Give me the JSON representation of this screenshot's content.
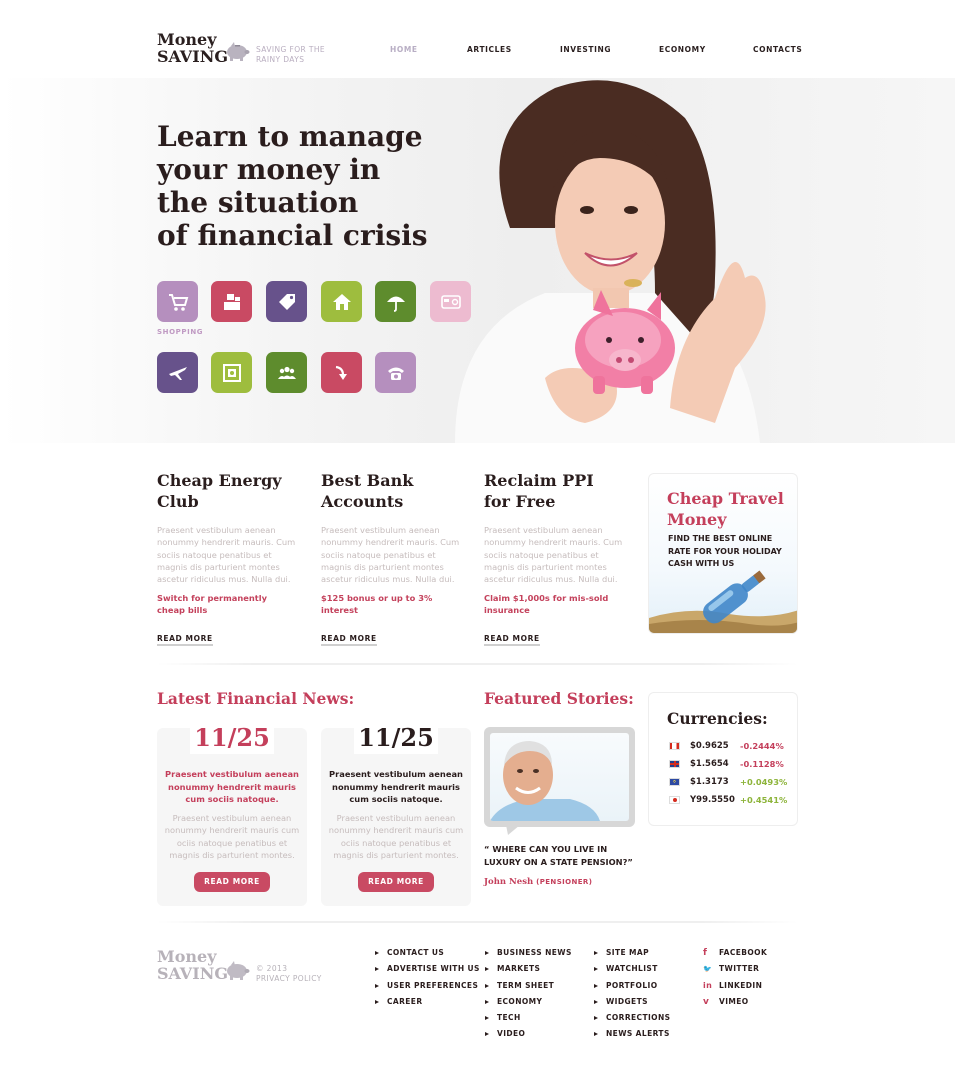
{
  "header": {
    "logo_line1": "Money",
    "logo_line2": "SAVING",
    "tagline_line1": "SAVING FOR THE",
    "tagline_line2": "RAINY DAYS",
    "nav": [
      "HOME",
      "ARTICLES",
      "INVESTING",
      "ECONOMY",
      "CONTACTS"
    ]
  },
  "hero": {
    "title_lines": [
      "Learn to manage",
      "your money in",
      "the situation",
      "of financial crisis"
    ],
    "tile_caption": "SHOPPING",
    "tiles": [
      {
        "icon": "cart-icon",
        "color": "#b58fbe"
      },
      {
        "icon": "cash-register-icon",
        "color": "#c94a63"
      },
      {
        "icon": "tag-icon",
        "color": "#67528b"
      },
      {
        "icon": "house-icon",
        "color": "#9ebd3e"
      },
      {
        "icon": "umbrella-icon",
        "color": "#5e8c2d"
      },
      {
        "icon": "credit-card-icon",
        "color": "#edbbd0"
      },
      {
        "icon": "airplane-icon",
        "color": "#67528b"
      },
      {
        "icon": "safe-icon",
        "color": "#9ebd3e"
      },
      {
        "icon": "people-icon",
        "color": "#5e8c2d"
      },
      {
        "icon": "arrow-down-icon",
        "color": "#c94a63"
      },
      {
        "icon": "phone-icon",
        "color": "#b58fbe"
      }
    ]
  },
  "columns": [
    {
      "title_lines": [
        "Cheap Energy",
        "Club"
      ],
      "body": "Praesent vestibulum aenean nonummy hendrerit mauris. Cum sociis natoque penatibus et magnis dis parturient montes ascetur ridiculus mus. Nulla dui.",
      "link_lines": [
        "Switch for permanently",
        "cheap bills"
      ],
      "read_more": "READ MORE"
    },
    {
      "title_lines": [
        "Best Bank",
        "Accounts"
      ],
      "body": "Praesent vestibulum aenean nonummy hendrerit mauris. Cum sociis natoque penatibus et magnis dis parturient montes ascetur ridiculus mus. Nulla dui.",
      "link_lines": [
        "$125 bonus or up to 3%",
        "interest"
      ],
      "read_more": "READ MORE"
    },
    {
      "title_lines": [
        "Reclaim PPI",
        "for Free"
      ],
      "body": "Praesent vestibulum aenean nonummy hendrerit mauris. Cum sociis natoque penatibus et magnis dis parturient montes ascetur ridiculus mus. Nulla dui.",
      "link_lines": [
        "Claim $1,000s for mis-sold",
        "insurance"
      ],
      "read_more": "READ MORE"
    }
  ],
  "travel": {
    "title_lines": [
      "Cheap Travel",
      "Money"
    ],
    "text_lines": [
      "FIND THE BEST ONLINE",
      "RATE FOR YOUR HOLIDAY",
      "CASH WITH US"
    ]
  },
  "news": {
    "title": "Latest Financial News:",
    "items": [
      {
        "date": "11/25",
        "lead": "Praesent vestibulum aenean nonummy hendrerit mauris cum sociis natoque.",
        "body": "Praesent vestibulum aenean nonummy hendrerit mauris cum ociis natoque penatibus et magnis dis parturient montes.",
        "button": "READ MORE",
        "accent": "#c43f5b"
      },
      {
        "date": "11/25",
        "lead": "Praesent vestibulum aenean nonummy hendrerit mauris cum sociis natoque.",
        "body": "Praesent vestibulum aenean nonummy hendrerit mauris cum ociis natoque penatibus et magnis dis parturient montes.",
        "button": "READ MORE",
        "accent": "#2a1d1d"
      }
    ]
  },
  "featured": {
    "title": "Featured Stories:",
    "quote_lines": [
      "“ WHERE CAN YOU LIVE IN",
      "LUXURY ON A STATE PENSION?”"
    ],
    "author": "John Nesh",
    "author_role": "(PENSIONER)"
  },
  "currencies": {
    "title": "Currencies:",
    "rows": [
      {
        "flag": "canada-flag-icon",
        "rate": "$0.9625",
        "change": "-0.2444%",
        "dir": "down"
      },
      {
        "flag": "uk-flag-icon",
        "rate": "$1.5654",
        "change": "-0.1128%",
        "dir": "down"
      },
      {
        "flag": "eu-flag-icon",
        "rate": "$1.3173",
        "change": "+0.0493%",
        "dir": "up"
      },
      {
        "flag": "japan-flag-icon",
        "rate": "Y99.5550",
        "change": "+0.4541%",
        "dir": "up"
      }
    ],
    "down_color": "#c43f5b",
    "up_color": "#8db43a"
  },
  "footer": {
    "logo_line1": "Money",
    "logo_line2": "SAVING",
    "copyright": "© 2013",
    "privacy": "PRIVACY POLICY",
    "col1": [
      "CONTACT US",
      "ADVERTISE WITH US",
      "USER PREFERENCES",
      "CAREER"
    ],
    "col2": [
      "BUSINESS NEWS",
      "MARKETS",
      "TERM SHEET",
      "ECONOMY",
      "TECH",
      "VIDEO"
    ],
    "col3": [
      "SITE MAP",
      "WATCHLIST",
      "PORTFOLIO",
      "WIDGETS",
      "CORRECTIONS",
      "NEWS ALERTS"
    ],
    "social": [
      {
        "icon": "facebook-icon",
        "glyph": "f",
        "label": "FACEBOOK"
      },
      {
        "icon": "twitter-icon",
        "glyph": "🐦",
        "label": "TWITTER"
      },
      {
        "icon": "linkedin-icon",
        "glyph": "in",
        "label": "LINKEDIN"
      },
      {
        "icon": "vimeo-icon",
        "glyph": "v",
        "label": "VIMEO"
      }
    ]
  }
}
